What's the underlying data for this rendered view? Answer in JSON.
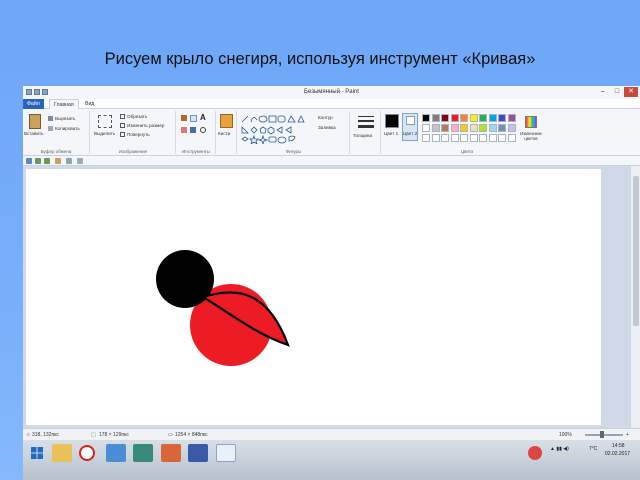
{
  "slide": {
    "title": "Рисуем крыло снегиря, используя инструмент «Кривая»"
  },
  "window": {
    "title": "Безымянный - Paint"
  },
  "menu": {
    "file": "Файл",
    "home": "Главная",
    "view": "Вид"
  },
  "ribbon": {
    "clipboard": {
      "paste": "Вставить",
      "cut": "Вырезать",
      "copy": "Копировать",
      "label": "Буфер обмена"
    },
    "image": {
      "select": "Выделить",
      "crop": "Обрезать",
      "resize": "Изменить размер",
      "rotate": "Повернуть",
      "label": "Изображение"
    },
    "tools": {
      "brushes": "Кисти",
      "label": "Инструменты"
    },
    "shapes": {
      "outline": "Контур",
      "fill": "Заливка",
      "label": "Фигуры"
    },
    "size": {
      "label": "Толщина"
    },
    "colors": {
      "color1": "Цвет 1",
      "color2": "Цвет 2",
      "edit": "Изменение цветов",
      "label": "Цвета",
      "palette_row1": [
        "#000000",
        "#7f7f7f",
        "#880015",
        "#ed1c24",
        "#ff7f27",
        "#fff200",
        "#22b14c",
        "#00a2e8",
        "#3f48cc",
        "#a349a4"
      ],
      "palette_row2": [
        "#ffffff",
        "#c3c3c3",
        "#b97a57",
        "#ffaec9",
        "#ffc90e",
        "#efe4b0",
        "#b5e61d",
        "#99d9ea",
        "#7092be",
        "#c8bfe7"
      ]
    }
  },
  "drawing": {
    "head_color": "#000000",
    "body_color": "#ed1c24",
    "wing_color": "#ed1c24"
  },
  "status": {
    "cursor": "318, 132пкс",
    "selection": "178 × 129пкс",
    "canvas_size": "1254 × 848пкс",
    "zoom": "100%"
  },
  "taskbar": {
    "clock_time": "14:58",
    "clock_date": "02.02.2017",
    "temp": "7°C"
  }
}
